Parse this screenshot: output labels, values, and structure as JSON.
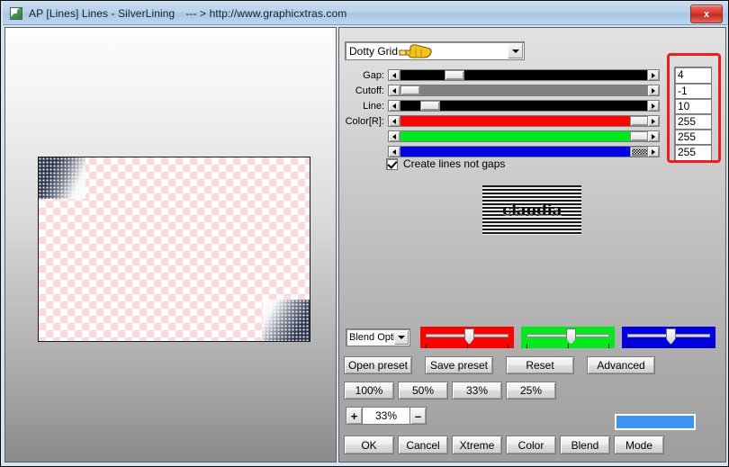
{
  "window": {
    "title": "AP [Lines]  Lines - SilverLining",
    "url": "--- > http://www.graphicxtras.com",
    "close_label": "x",
    "icon": "app-icon"
  },
  "effect_combo": {
    "value": "Dotty Grid",
    "arrow": "chevron-down-icon",
    "cursor": "pointing-hand-cursor"
  },
  "sliders": [
    {
      "label": "Gap:",
      "value": "4",
      "thumb_pct": 18,
      "fill": "#000000",
      "name": "gap"
    },
    {
      "label": "Cutoff:",
      "value": "-1",
      "thumb_pct": 0,
      "fill": "#808080",
      "name": "cutoff"
    },
    {
      "label": "Line:",
      "value": "10",
      "thumb_pct": 8,
      "fill": "#000000",
      "name": "line"
    },
    {
      "label": "Color[R]:",
      "value": "255",
      "thumb_pct": 93,
      "fill": "#ff0000",
      "name": "color-r"
    },
    {
      "label": "",
      "value": "255",
      "thumb_pct": 93,
      "fill": "#00e81e",
      "name": "color-g"
    },
    {
      "label": "",
      "value": "255",
      "thumb_pct": 93,
      "fill": "#0000e0",
      "name": "color-b"
    }
  ],
  "checkbox": {
    "label": "Create lines not gaps",
    "checked": true
  },
  "logo_preview": {
    "text": "claudia"
  },
  "blend_combo": {
    "value": "Blend Opti",
    "arrow": "chevron-down-icon"
  },
  "blend_trackbars": [
    {
      "name": "blend-red",
      "color": "#ff0000",
      "thumb_pct": 47
    },
    {
      "name": "blend-green",
      "color": "#00e81e",
      "thumb_pct": 48
    },
    {
      "name": "blend-blue",
      "color": "#0000e0",
      "thumb_pct": 47
    }
  ],
  "preset_buttons": [
    {
      "label": "Open preset",
      "name": "open-preset"
    },
    {
      "label": "Save preset",
      "name": "save-preset"
    },
    {
      "label": "Reset",
      "name": "reset"
    },
    {
      "label": "Advanced",
      "name": "advanced"
    }
  ],
  "zoom_buttons": [
    {
      "label": "100%",
      "name": "zoom-100"
    },
    {
      "label": "50%",
      "name": "zoom-50"
    },
    {
      "label": "33%",
      "name": "zoom-33"
    },
    {
      "label": "25%",
      "name": "zoom-25"
    }
  ],
  "stepper": {
    "plus": "+",
    "value": "33%",
    "minus": "–"
  },
  "progress_swatch": {
    "color": "#3d93f0"
  },
  "action_buttons": [
    {
      "label": "OK",
      "name": "ok"
    },
    {
      "label": "Cancel",
      "name": "cancel"
    },
    {
      "label": "Xtreme",
      "name": "xtreme"
    },
    {
      "label": "Color",
      "name": "color"
    },
    {
      "label": "Blend",
      "name": "blend"
    },
    {
      "label": "Mode",
      "name": "mode"
    }
  ],
  "colors": {
    "accent_blue": "#3d93f0",
    "annotation_red": "#ee1c1c",
    "checker_pink": "#ffd9dc"
  }
}
